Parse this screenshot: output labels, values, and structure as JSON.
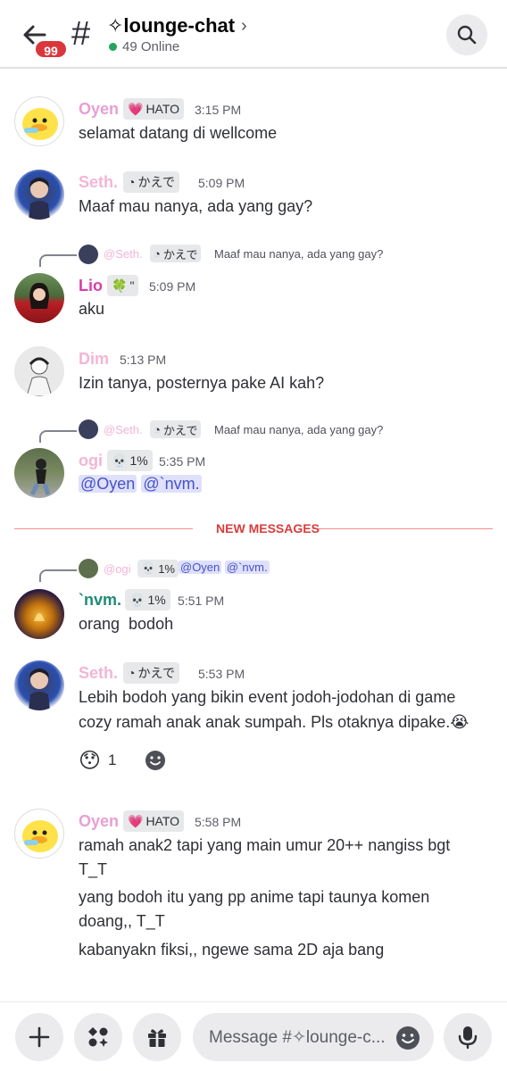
{
  "header": {
    "unread_badge": "99",
    "hash": "#",
    "channel_name": "✧lounge-chat",
    "chevron": "›",
    "online": "49 Online",
    "icons": [
      "back-arrow-icon",
      "search-icon"
    ]
  },
  "messages": [
    {
      "username": "Oyen",
      "name_color": "#e89fd3",
      "tag_icon": "💗",
      "tag": "HATO",
      "time": "3:15 PM",
      "lines": [
        "selamat datang di wellcome"
      ]
    },
    {
      "username": "Seth.",
      "name_color": "#f2b5d6",
      "tag_icon": "◔",
      "tag": "かえで",
      "time": "5:09 PM",
      "lines": [
        "Maaf mau nanya, ada yang gay?"
      ]
    },
    {
      "reply": {
        "name": "@Seth.",
        "tag_icon": "◔",
        "tag": "かえで",
        "text": "Maaf mau nanya, ada yang gay?"
      },
      "username": "Lio",
      "name_color": "#d63ea9",
      "tag_icon": "🍀",
      "tag": "\"",
      "time": "5:09 PM",
      "lines": [
        "aku"
      ]
    },
    {
      "username": "Dim",
      "name_color": "#f2b5d6",
      "time": "5:13 PM",
      "lines": [
        "Izin tanya, posternya pake AI kah?"
      ]
    },
    {
      "reply": {
        "name": "@Seth.",
        "tag_icon": "◔",
        "tag": "かえで",
        "text": "Maaf mau nanya, ada yang gay?"
      },
      "username": "ogi",
      "name_color": "#f2b5d6",
      "tag_icon": "💀",
      "tag": "1%",
      "time": "5:35 PM",
      "mentions": [
        "@Oyen",
        "@`nvm."
      ]
    },
    {
      "reply": {
        "name": "@ogi",
        "tag_icon": "💀",
        "tag": "1%",
        "mentions": [
          "@Oyen",
          "@`nvm."
        ]
      },
      "username": "`nvm.",
      "name_color": "#1f8b76",
      "tag_icon": "💀",
      "tag": "1%",
      "time": "5:51 PM",
      "lines": [
        "orang  bodoh"
      ]
    },
    {
      "username": "Seth.",
      "name_color": "#f2b5d6",
      "tag_icon": "◔",
      "tag": "かえで",
      "time": "5:53 PM",
      "lines": [
        "Lebih bodoh yang bikin event jodoh-jodohan di game",
        "cozy ramah anak anak sumpah. Pls otaknya dipake.😭"
      ],
      "reaction": {
        "emoji": "😯",
        "count": "1"
      }
    },
    {
      "username": "Oyen",
      "name_color": "#e89fd3",
      "tag_icon": "💗",
      "tag": "HATO",
      "time": "5:58 PM",
      "lines": [
        "ramah anak2 tapi yang main umur 20++ nangiss bgt",
        "T_T",
        "yang bodoh itu yang pp anime tapi taunya komen",
        "doang,, T_T",
        "kabanyakn fiksi,, ngewe sama 2D aja bang"
      ]
    }
  ],
  "divider": {
    "label": "NEW MESSAGES"
  },
  "composer": {
    "placeholder": "Message #✧lounge-c...",
    "icons": [
      "plus-icon",
      "apps-icon",
      "gift-icon",
      "emoji-icon",
      "microphone-icon"
    ]
  },
  "colors": {
    "accent_red": "#da373c",
    "mention_bg": "#dee0fc",
    "mention_fg": "#4752c4",
    "online_green": "#23a55a"
  }
}
